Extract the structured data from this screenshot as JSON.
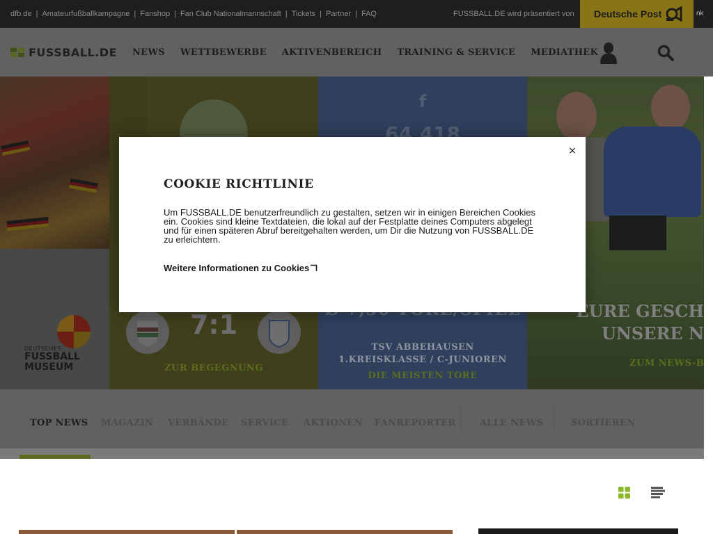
{
  "topbar": {
    "links": [
      "dfb.de",
      "Amateurfußballkampagne",
      "Fanshop",
      "Fan Club Nationalmannschaft",
      "Tickets",
      "Partner",
      "FAQ"
    ],
    "separator": "|",
    "presented_by": "FUSSBALL.DE wird präsentiert von",
    "sponsor": "Deutsche Post",
    "cut_text": "nk"
  },
  "nav": {
    "logo": "FUSSBALL.DE",
    "items": [
      "NEWS",
      "WETTBEWERBE",
      "AKTIVENBEREICH",
      "TRAINING & SERVICE",
      "MEDIATHEK"
    ]
  },
  "hero": {
    "museum_line1": "DEUTSCHES",
    "museum_line2": "FUSSBALL",
    "museum_line3": "MUSEUM",
    "score": "7:1",
    "match_link": "ZUR BEGEGNUNG",
    "facebook_glyph": "f",
    "facebook_count": "64.418",
    "goals_text": "Ø 7,50 TORE/SPIEL",
    "team": "TSV ABBEHAUSEN",
    "league": "1.KREISKLASSE / C-JUNIOREN",
    "stats_link": "DIE MEISTEN TORE",
    "stories_line1": "EURE GESCH",
    "stories_line2": "UNSERE N",
    "news_link": "ZUM NEWS-BE"
  },
  "tabs": {
    "items": [
      "TOP NEWS",
      "MAGAZIN",
      "VERBÄNDE",
      "SERVICE",
      "AKTIONEN",
      "FANREPORTER",
      "ALLE NEWS",
      "SORTIEREN"
    ],
    "active_index": 0
  },
  "cookie": {
    "title": "COOKIE RICHTLINIE",
    "body": "Um FUSSBALL.DE benutzerfreundlich zu gestalten, setzen wir in einigen Bereichen Cookies ein. Cookies sind kleine Textdateien, die lokal auf der Festplatte deines Computers abgelegt und für einen späteren Abruf bereitgehalten werden, um Dir die Nutzung von FUSSBALL.DE zu erleichtern.",
    "more_link": "Weitere Informationen zu Cookies",
    "close": "×"
  },
  "icons": {
    "user": "user-icon",
    "search": "search-icon",
    "grid": "grid-view-icon",
    "list": "list-view-icon",
    "external": "external-link-icon",
    "post_horn": "post-horn-icon"
  },
  "colors": {
    "accent_green": "#8cb82b",
    "post_yellow": "#ffcc00",
    "dark_bar": "#1e1e1e",
    "nav_gray": "#f2f2f2"
  }
}
